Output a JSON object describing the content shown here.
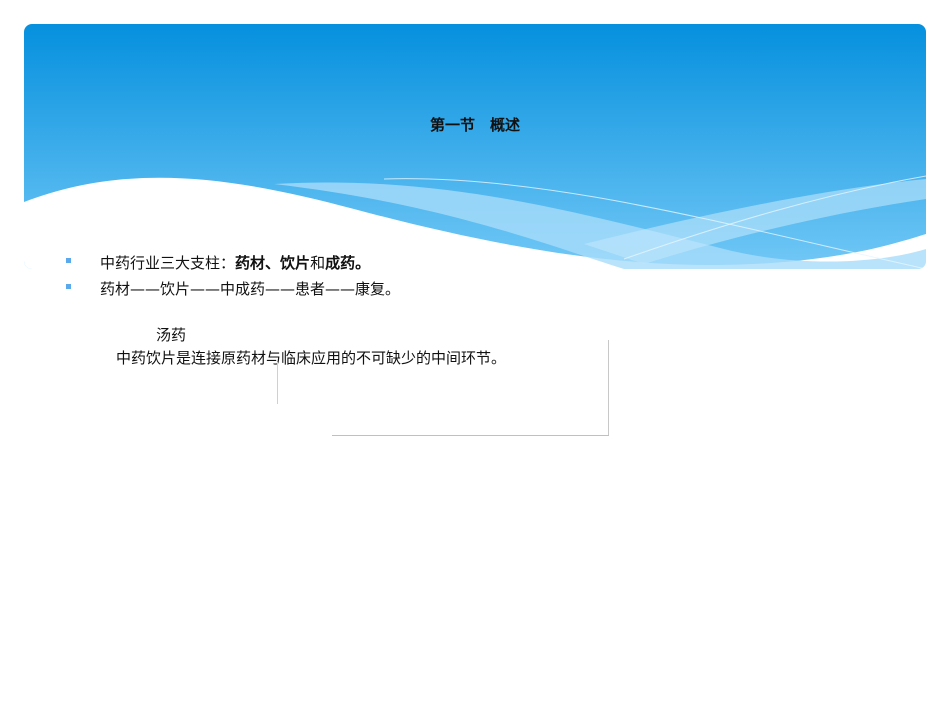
{
  "slide": {
    "title": "第一节　概述",
    "bullets": [
      {
        "parts": [
          "中药行业三大支柱：",
          "药材",
          "、",
          "饮片",
          "和",
          "成药",
          "。"
        ]
      },
      {
        "text": "药材——饮片——中成药——患者——康复。"
      }
    ],
    "label": "汤药",
    "summary": "中药饮片是连接原药材与临床应用的不可缺少的中间环节。"
  },
  "colors": {
    "header_top": "#0590de",
    "header_bottom": "#6cc4f4",
    "bullet": "#5aa9ec"
  }
}
